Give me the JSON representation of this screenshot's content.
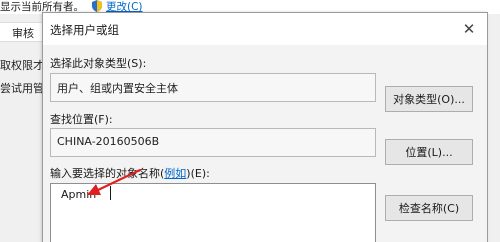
{
  "background": {
    "owner_text": "显示当前所有者。",
    "change_link": "更改(C)",
    "tab_audit": "审核",
    "text_1": "取权限才",
    "text_2": "尝试用管"
  },
  "dialog": {
    "title": "选择用户或组",
    "close_glyph": "✕",
    "object_type": {
      "label": "选择此对象类型(S):",
      "value": "用户、组或内置安全主体",
      "button": "对象类型(O)..."
    },
    "location": {
      "label": "查找位置(F):",
      "value": "CHINA-20160506B",
      "button": "位置(L)..."
    },
    "names": {
      "label_prefix": "输入要选择的对象名称(",
      "example_link": "例如",
      "label_suffix": ")(E):",
      "value": "Apmin",
      "button": "检查名称(C)"
    }
  },
  "annotation": {
    "arrow_color": "#e02020"
  }
}
